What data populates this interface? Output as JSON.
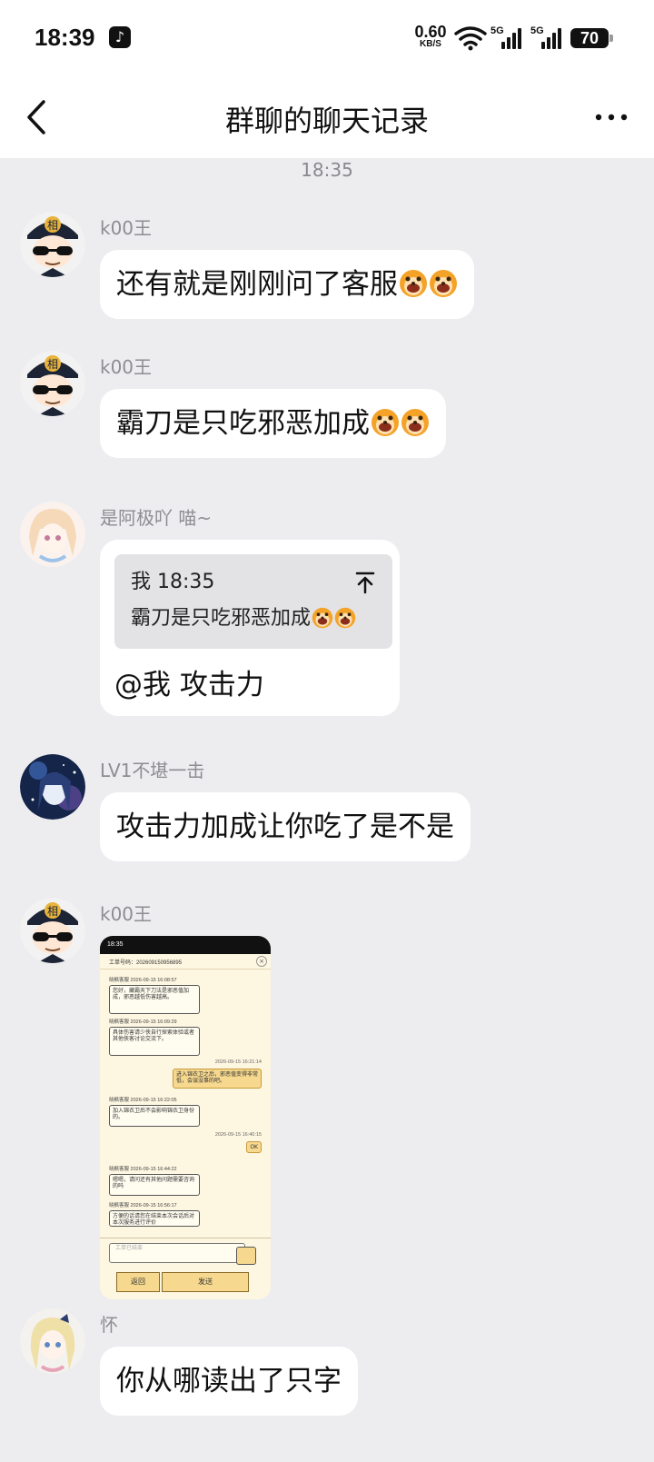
{
  "status_bar": {
    "time": "18:39",
    "app_icon": "tiktok-icon",
    "net_speed": "0.60",
    "net_unit": "KB/S",
    "sim1": "5G",
    "sim2": "5G",
    "battery": "70"
  },
  "nav": {
    "title": "群聊的聊天记录",
    "back_icon": "back-chevron-icon",
    "more_icon": "more-icon"
  },
  "timestamp": "18:35",
  "messages": [
    {
      "sender": "k00王",
      "avatar": "avatar-detective",
      "text": "还有就是刚刚问了客服",
      "emoji": "doge-emoji"
    },
    {
      "sender": "k00王",
      "avatar": "avatar-detective",
      "text": "霸刀是只吃邪恶加成",
      "emoji": "doge-emoji"
    },
    {
      "sender": "是阿极吖 喵~",
      "avatar": "avatar-anime-girl",
      "quote": {
        "head": "我 18:35",
        "text": "霸刀是只吃邪恶加成"
      },
      "text": "@我 攻击力"
    },
    {
      "sender": "LV1不堪一击",
      "avatar": "avatar-galaxy",
      "text": "攻击力加成让你吃了是不是"
    },
    {
      "sender": "k00王",
      "avatar": "avatar-detective",
      "image": {
        "status_time": "18:35",
        "ticket": "工单号码：202609150956895",
        "entries": [
          {
            "side": "left",
            "name": "晓枫客服",
            "time": "2026-09-15 16:08:57",
            "text": "您好，藏霸天下刀法是邪恶值加成，邪恶越低伤害越高。"
          },
          {
            "side": "left",
            "name": "晓枫客服",
            "time": "2026-09-15 16:09:29",
            "text": "具体伤害请少侠自行探索体验或者其他侠客讨论交流下。"
          },
          {
            "side": "right",
            "time": "2026-09-15 16:21:14",
            "text": "进入锦衣卫之后，邪恶值变得非常低，会误没事的吧。"
          },
          {
            "side": "left",
            "name": "晓枫客服",
            "time": "2026-09-15 16:22:05",
            "text": "加入锦衣卫后不会影响锦衣卫身份的。"
          },
          {
            "side": "right",
            "time": "2026-09-15 16:40:15",
            "text": "OK"
          },
          {
            "side": "left",
            "name": "晓枫客服",
            "time": "2026-09-15 16:44:22",
            "text": "嗯嗯，请问还有其他问题需要咨询的吗"
          },
          {
            "side": "left",
            "name": "晓枫客服",
            "time": "2026-09-15 16:56:17",
            "text": "方便的话请您在结束本次会话后对本次服务进行评价"
          }
        ],
        "input_placeholder": "工单已结束",
        "back_label": "返回",
        "send_label": "发送"
      }
    },
    {
      "sender": "怀",
      "avatar": "avatar-blonde-girl",
      "text": "你从哪读出了只字"
    }
  ],
  "colors": {
    "background": "#ededf0",
    "bubble": "#ffffff",
    "sender_text": "#8d8d92",
    "quote_bg": "#e3e3e6"
  }
}
